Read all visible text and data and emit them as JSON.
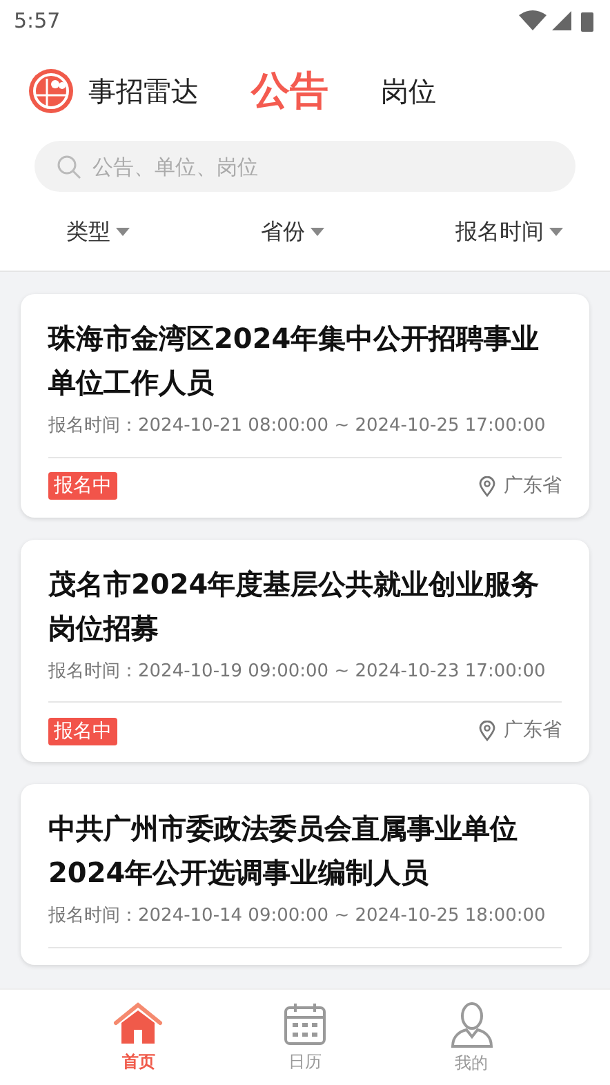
{
  "status_bar": {
    "time": "5:57"
  },
  "header": {
    "app_name": "事招雷达",
    "tabs": [
      {
        "label": "公告",
        "selected": true
      },
      {
        "label": "岗位",
        "selected": false
      }
    ]
  },
  "search": {
    "placeholder": "公告、单位、岗位"
  },
  "filters": [
    {
      "label": "类型"
    },
    {
      "label": "省份"
    },
    {
      "label": "报名时间"
    }
  ],
  "notices": [
    {
      "title": "珠海市金湾区2024年集中公开招聘事业单位工作人员",
      "time": "报名时间：2024-10-21 08:00:00 ~ 2024-10-25 17:00:00",
      "status": "报名中",
      "province": "广东省"
    },
    {
      "title": "茂名市2024年度基层公共就业创业服务岗位招募",
      "time": "报名时间：2024-10-19 09:00:00 ~ 2024-10-23 17:00:00",
      "status": "报名中",
      "province": "广东省"
    },
    {
      "title": "中共广州市委政法委员会直属事业单位2024年公开选调事业编制人员",
      "time": "报名时间：2024-10-14 09:00:00 ~ 2024-10-25 18:00:00"
    }
  ],
  "bottom_nav": [
    {
      "label": "首页",
      "kind": "home",
      "selected": true
    },
    {
      "label": "日历",
      "kind": "calendar",
      "selected": false
    },
    {
      "label": "我的",
      "kind": "profile",
      "selected": false
    }
  ]
}
